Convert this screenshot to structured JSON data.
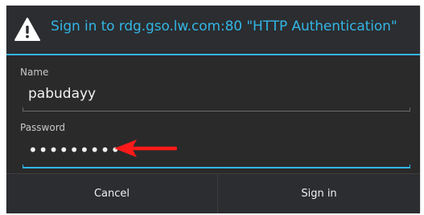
{
  "dialog": {
    "title": "Sign in to rdg.gso.lw.com:80 \"HTTP Authentication\"",
    "title_icon": "warning-icon",
    "accent_color": "#33b5e5"
  },
  "form": {
    "name_label": "Name",
    "name_value": "pabudayy",
    "password_label": "Password",
    "password_value": "•••••••••"
  },
  "annotation": {
    "arrow_color": "#ff1a1a",
    "arrow_icon": "red-arrow-left-icon"
  },
  "buttons": {
    "cancel_label": "Cancel",
    "signin_label": "Sign in"
  }
}
